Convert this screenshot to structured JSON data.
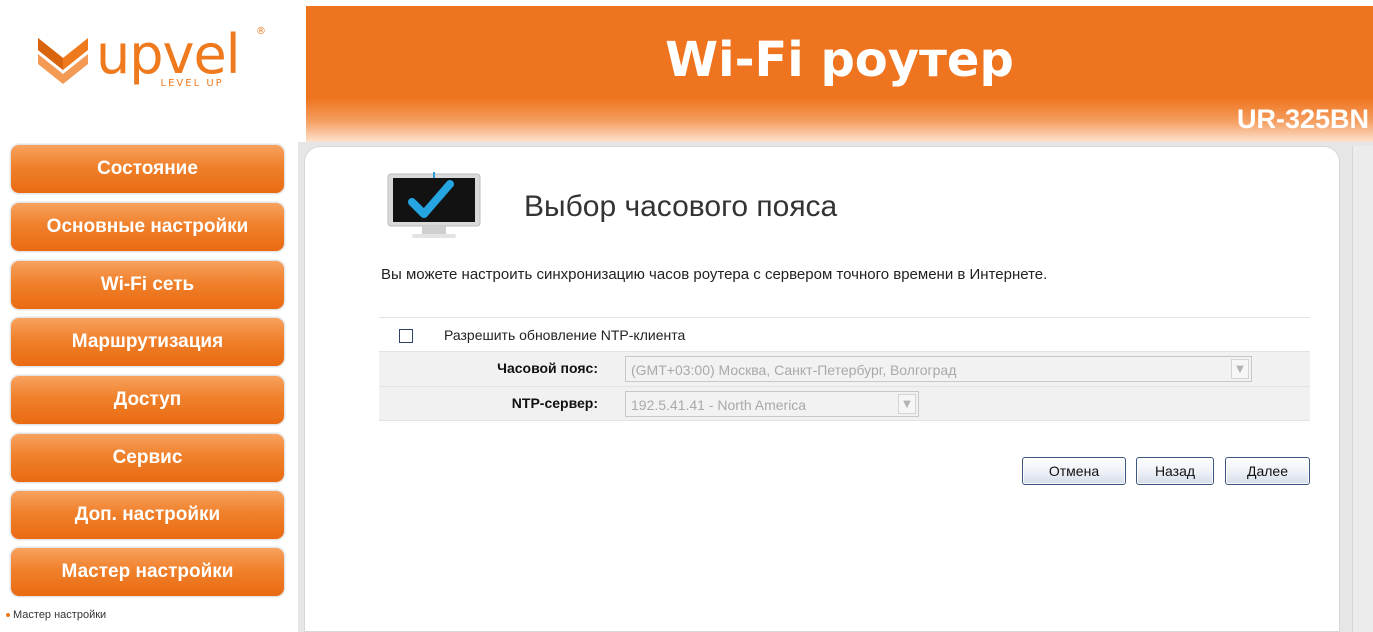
{
  "brand": {
    "logo_word": "upvel",
    "logo_tagline": "LEVEL UP",
    "logo_reg": "®",
    "accent_color": "#ef7a1e"
  },
  "header": {
    "title": "Wi-Fi роутер",
    "model": "UR-325BN"
  },
  "sidebar": {
    "items": [
      {
        "label": "Состояние"
      },
      {
        "label": "Основные настройки"
      },
      {
        "label": "Wi-Fi сеть"
      },
      {
        "label": "Маршрутизация"
      },
      {
        "label": "Доступ"
      },
      {
        "label": "Сервис"
      },
      {
        "label": "Доп. настройки"
      },
      {
        "label": "Мастер настройки"
      }
    ],
    "sub_items": [
      {
        "label": "Мастер настройки"
      }
    ]
  },
  "main": {
    "icon": "monitor-check-icon",
    "title": "Выбор часового пояса",
    "description": "Вы можете настроить синхронизацию часов роутера с сервером точного времени в Интернете.",
    "ntp_checkbox": {
      "label": "Разрешить обновление NTP-клиента",
      "checked": false
    },
    "timezone": {
      "label": "Часовой пояс:",
      "value": "(GMT+03:00) Москва, Санкт-Петербург, Волгоград"
    },
    "ntp_server": {
      "label": "NTP-сервер:",
      "value": "192.5.41.41 - North America"
    }
  },
  "buttons": {
    "cancel": "Отмена",
    "back": "Назад",
    "next": "Далее"
  }
}
